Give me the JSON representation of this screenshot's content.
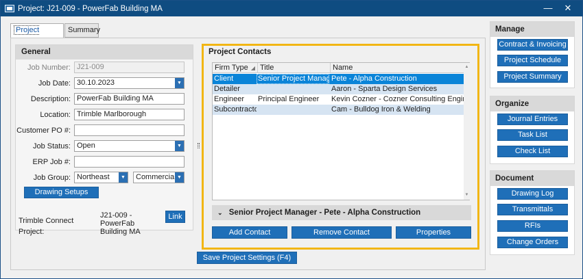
{
  "window": {
    "title": "Project:  J21-009 - PowerFab Building MA",
    "minimize": "—",
    "maximize": "☐",
    "close": "✕"
  },
  "tabs": [
    {
      "label": "Project Settings",
      "active": true
    },
    {
      "label": "Summary",
      "active": false
    }
  ],
  "general": {
    "header": "General",
    "job_number": {
      "label": "Job Number:",
      "value": "J21-009"
    },
    "job_date": {
      "label": "Job Date:",
      "value": "30.10.2023"
    },
    "description": {
      "label": "Description:",
      "value": "PowerFab Building MA"
    },
    "location": {
      "label": "Location:",
      "value": "Trimble Marlborough"
    },
    "customer_po": {
      "label": "Customer PO #:",
      "value": ""
    },
    "job_status": {
      "label": "Job Status:",
      "value": "Open"
    },
    "erp_job": {
      "label": "ERP Job #:",
      "value": ""
    },
    "job_group": {
      "label": "Job Group:",
      "value1": "Northeast",
      "value2": "Commercial"
    },
    "drawing_setups_button": "Drawing Setups",
    "trimble_connect": {
      "label": "Trimble Connect Project:",
      "value_line1": "J21-009 - PowerFab",
      "value_line2": "Building MA",
      "link_button": "Link"
    }
  },
  "contacts": {
    "header": "Project Contacts",
    "columns": [
      "Firm Type",
      "Title",
      "Name"
    ],
    "rows": [
      {
        "firm_type": "Client",
        "title": "Senior Project Manager",
        "name": "Pete - Alpha Construction"
      },
      {
        "firm_type": "Detailer",
        "title": "",
        "name": "Aaron - Sparta Design Services"
      },
      {
        "firm_type": "Engineer",
        "title": "Principal Engineer",
        "name": "Kevin Cozner - Cozner Consulting Engineers"
      },
      {
        "firm_type": "Subcontractor",
        "title": "",
        "name": "Cam - Bulldog Iron & Welding"
      }
    ],
    "detail_label": "Senior Project Manager - Pete - Alpha Construction",
    "add_button": "Add Contact",
    "remove_button": "Remove Contact",
    "properties_button": "Properties"
  },
  "save_button": "Save Project Settings (F4)",
  "sidebar": {
    "manage": {
      "header": "Manage",
      "items": [
        "Contract & Invoicing",
        "Project Schedule",
        "Project Summary"
      ]
    },
    "organize": {
      "header": "Organize",
      "items": [
        "Journal Entries",
        "Task List",
        "Check List"
      ]
    },
    "document": {
      "header": "Document",
      "items": [
        "Drawing Log",
        "Transmittals",
        "RFIs",
        "Change Orders"
      ]
    }
  },
  "colors": {
    "title_bar": "#0f4c81",
    "button": "#1f6fb8",
    "selection": "#0a84d8",
    "highlight_border": "#f2b614"
  }
}
